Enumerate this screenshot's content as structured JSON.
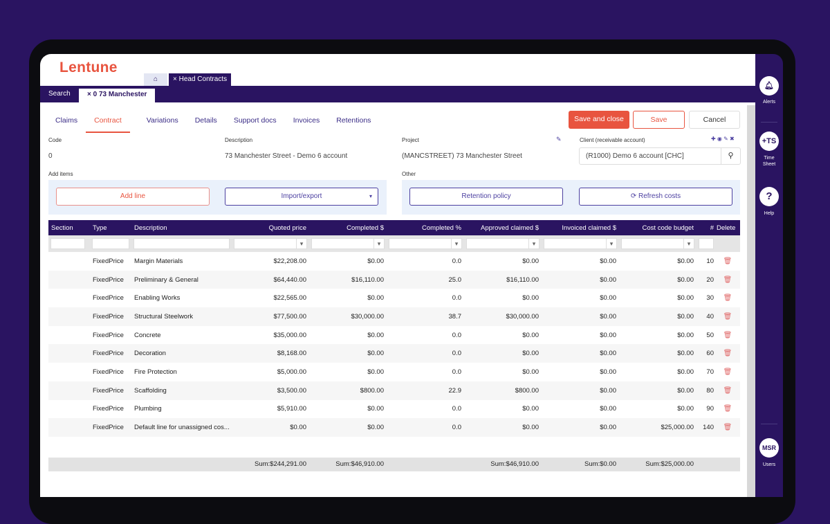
{
  "app": {
    "logo": "Lentune"
  },
  "top_tabs": {
    "home_icon": "home-icon",
    "head_contracts": "× Head Contracts"
  },
  "sub_tabs": {
    "search": "Search",
    "record": "× 0 73 Manchester"
  },
  "nav_tabs": [
    {
      "label": "Claims"
    },
    {
      "label": "Contract",
      "active": true
    },
    {
      "label": "Variations"
    },
    {
      "label": "Details"
    },
    {
      "label": "Support docs"
    },
    {
      "label": "Invoices"
    },
    {
      "label": "Retentions"
    }
  ],
  "actions": {
    "save_close": "Save and close",
    "save": "Save",
    "cancel": "Cancel"
  },
  "fields": {
    "code_label": "Code",
    "code_value": "0",
    "description_label": "Description",
    "description_value": "73 Manchester Street - Demo 6 account",
    "project_label": "Project",
    "project_value": "(MANCSTREET) 73 Manchester Street",
    "client_label": "Client (receivable account)",
    "client_value": "(R1000) Demo 6 account [CHC]",
    "add_items_label": "Add items",
    "other_label": "Other"
  },
  "buttons": {
    "add_line": "Add line",
    "import_export": "Import/export",
    "retention_policy": "Retention policy",
    "refresh_costs": "Refresh costs"
  },
  "table": {
    "columns": [
      "Section",
      "Type",
      "Description",
      "Quoted price",
      "Completed $",
      "Completed %",
      "Approved claimed $",
      "Invoiced claimed $",
      "Cost code budget",
      "#",
      "Delete"
    ],
    "rows": [
      [
        "",
        "FixedPrice",
        "Margin Materials",
        "$22,208.00",
        "$0.00",
        "0.0",
        "$0.00",
        "$0.00",
        "$0.00",
        "10"
      ],
      [
        "",
        "FixedPrice",
        "Preliminary & General",
        "$64,440.00",
        "$16,110.00",
        "25.0",
        "$16,110.00",
        "$0.00",
        "$0.00",
        "20"
      ],
      [
        "",
        "FixedPrice",
        "Enabling Works",
        "$22,565.00",
        "$0.00",
        "0.0",
        "$0.00",
        "$0.00",
        "$0.00",
        "30"
      ],
      [
        "",
        "FixedPrice",
        "Structural Steelwork",
        "$77,500.00",
        "$30,000.00",
        "38.7",
        "$30,000.00",
        "$0.00",
        "$0.00",
        "40"
      ],
      [
        "",
        "FixedPrice",
        "Concrete",
        "$35,000.00",
        "$0.00",
        "0.0",
        "$0.00",
        "$0.00",
        "$0.00",
        "50"
      ],
      [
        "",
        "FixedPrice",
        "Decoration",
        "$8,168.00",
        "$0.00",
        "0.0",
        "$0.00",
        "$0.00",
        "$0.00",
        "60"
      ],
      [
        "",
        "FixedPrice",
        "Fire Protection",
        "$5,000.00",
        "$0.00",
        "0.0",
        "$0.00",
        "$0.00",
        "$0.00",
        "70"
      ],
      [
        "",
        "FixedPrice",
        "Scaffolding",
        "$3,500.00",
        "$800.00",
        "22.9",
        "$800.00",
        "$0.00",
        "$0.00",
        "80"
      ],
      [
        "",
        "FixedPrice",
        "Plumbing",
        "$5,910.00",
        "$0.00",
        "0.0",
        "$0.00",
        "$0.00",
        "$0.00",
        "90"
      ],
      [
        "",
        "FixedPrice",
        "Default line for unassigned cos...",
        "$0.00",
        "$0.00",
        "0.0",
        "$0.00",
        "$0.00",
        "$25,000.00",
        "140"
      ]
    ],
    "sums": [
      "",
      "",
      "",
      "Sum:$244,291.00",
      "Sum:$46,910.00",
      "",
      "Sum:$46,910.00",
      "Sum:$0.00",
      "Sum:$25,000.00",
      "",
      ""
    ]
  },
  "right_bar": [
    {
      "icon": "bell-icon",
      "text": "",
      "label": "Alerts"
    },
    {
      "icon": "timesheet-icon",
      "text": "+TS",
      "label": "Time Sheet"
    },
    {
      "icon": "help-icon",
      "text": "?",
      "label": "Help"
    },
    {
      "icon": "user-avatar",
      "text": "MSR",
      "label": "Users"
    }
  ],
  "colors": {
    "brand": "#e8543f",
    "primary": "#2a1461"
  }
}
